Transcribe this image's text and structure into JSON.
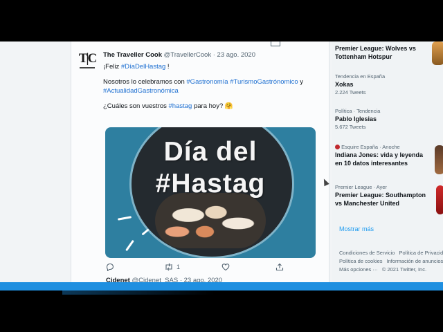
{
  "tweet": {
    "avatar_text": "T|C",
    "display_name": "The Traveller Cook",
    "handle": "@TravellerCook",
    "separator": "·",
    "date": "23 ago. 2020",
    "line1_prefix": "¡Feliz ",
    "line1_tag": "#DíaDelHastag",
    "line1_suffix": " !",
    "line2_prefix": "Nosotros lo celebramos con ",
    "line2_tag1": "#Gastronomía",
    "line2_tag2": "#TurismoGastrónomico",
    "line2_mid": " y",
    "line2_tag3": "#ActualidadGastronómica",
    "line3_prefix": "¿Cuáles son vuestros ",
    "line3_tag": "#hastag",
    "line3_suffix": " para hoy? 🤗",
    "card_line1": "Día del",
    "card_line2": "#Hastag",
    "retweets": "1"
  },
  "next_tweet": {
    "display_name": "Cidenet",
    "handle": "@Cidenet_SAS",
    "date": "23 ago. 2020"
  },
  "trends": [
    {
      "meta": "",
      "title": "Premier League: Wolves vs Tottenham Hotspur",
      "count": ""
    },
    {
      "meta": "Tendencia en España",
      "title": "Xokas",
      "count": "2.224 Tweets"
    },
    {
      "meta": "Política · Tendencia",
      "title": "Pablo Iglesias",
      "count": "5.672 Tweets"
    },
    {
      "meta": "Esquire España · Anoche",
      "title": "Indiana Jones: vida y leyenda en 10 datos interesantes",
      "count": ""
    },
    {
      "meta": "Premier League · Ayer",
      "title": "Premier League: Southampton vs Manchester United",
      "count": ""
    }
  ],
  "show_more": "Mostrar más",
  "footer": {
    "terms": "Condiciones de Servicio",
    "privacy": "Política de Privacidad",
    "cookies": "Política de cookies",
    "ads": "Información de anuncios",
    "more": "Más opciones ···",
    "copyright": "© 2021 Twitter, Inc."
  },
  "colors": {
    "link": "#1d6fd1",
    "card_bg": "#2e7fa0",
    "taskbar": "#1f8fe0"
  }
}
